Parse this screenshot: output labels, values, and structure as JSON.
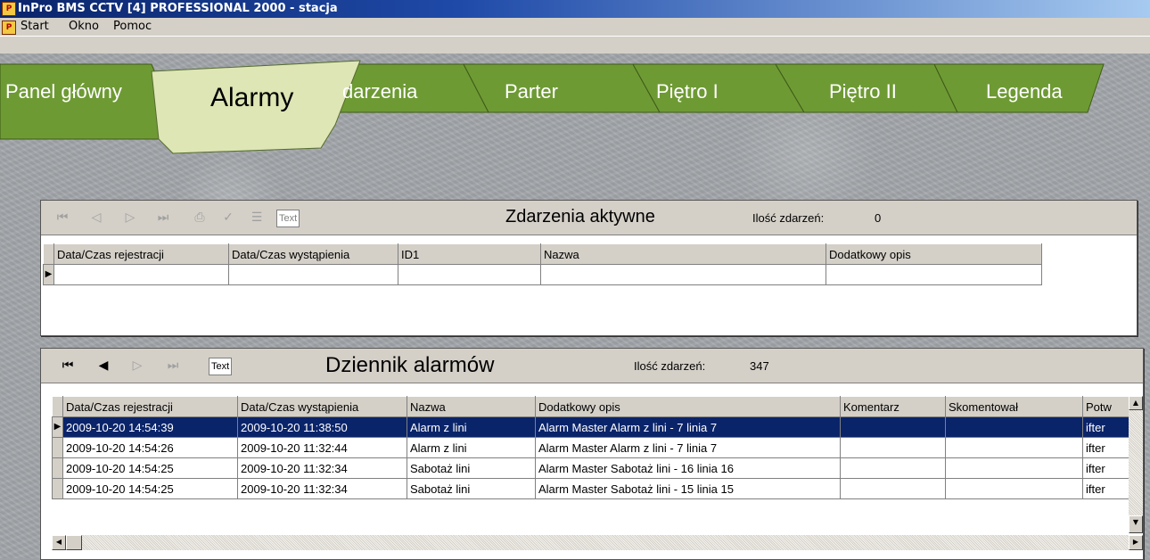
{
  "window": {
    "title": "InPro BMS CCTV [4] PROFESSIONAL 2000 - stacja",
    "icon": "app-icon"
  },
  "menu": {
    "items": [
      "Start",
      "Okno",
      "Pomoc"
    ]
  },
  "tabs": [
    {
      "label": "Panel główny",
      "active": false
    },
    {
      "label": "Alarmy",
      "active": true
    },
    {
      "label": "darzenia",
      "active": false
    },
    {
      "label": "Parter",
      "active": false
    },
    {
      "label": "Piętro I",
      "active": false
    },
    {
      "label": "Piętro II",
      "active": false
    },
    {
      "label": "Legenda",
      "active": false
    }
  ],
  "colors": {
    "tab_green": "#6e9a34",
    "tab_active": "#dde6b4",
    "selection": "#0a246a"
  },
  "active_events": {
    "title": "Zdarzenia aktywne",
    "count_label": "Ilość zdarzeń:",
    "count": "0",
    "text_button": "Text",
    "columns": [
      "Data/Czas rejestracji",
      "Data/Czas wystąpienia",
      "ID1",
      "Nazwa",
      "Dodatkowy opis"
    ],
    "rows": []
  },
  "alarm_log": {
    "title": "Dziennik alarmów",
    "count_label": "Ilość zdarzeń:",
    "count": "347",
    "text_button": "Text",
    "columns": [
      "Data/Czas rejestracji",
      "Data/Czas wystąpienia",
      "Nazwa",
      "Dodatkowy opis",
      "Komentarz",
      "Skomentował",
      "Potw"
    ],
    "rows": [
      [
        "2009-10-20 14:54:39",
        "2009-10-20 11:38:50",
        "Alarm z lini",
        "Alarm Master Alarm z lini - 7 linia 7",
        "",
        "",
        "ifter"
      ],
      [
        "2009-10-20 14:54:26",
        "2009-10-20 11:32:44",
        "Alarm z lini",
        "Alarm Master Alarm z lini - 7 linia 7",
        "",
        "",
        "ifter"
      ],
      [
        "2009-10-20 14:54:25",
        "2009-10-20 11:32:34",
        "Sabotaż lini",
        "Alarm Master Sabotaż lini - 16 linia 16",
        "",
        "",
        "ifter"
      ],
      [
        "2009-10-20 14:54:25",
        "2009-10-20 11:32:34",
        "Sabotaż lini",
        "Alarm Master Sabotaż lini - 15 linia 15",
        "",
        "",
        "ifter"
      ]
    ],
    "selected_row": 0
  }
}
